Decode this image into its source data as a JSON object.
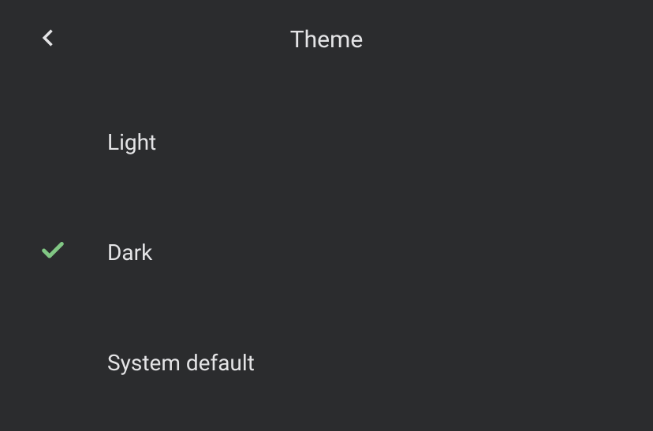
{
  "header": {
    "title": "Theme"
  },
  "options": [
    {
      "label": "Light",
      "selected": false
    },
    {
      "label": "Dark",
      "selected": true
    },
    {
      "label": "System default",
      "selected": false
    }
  ]
}
